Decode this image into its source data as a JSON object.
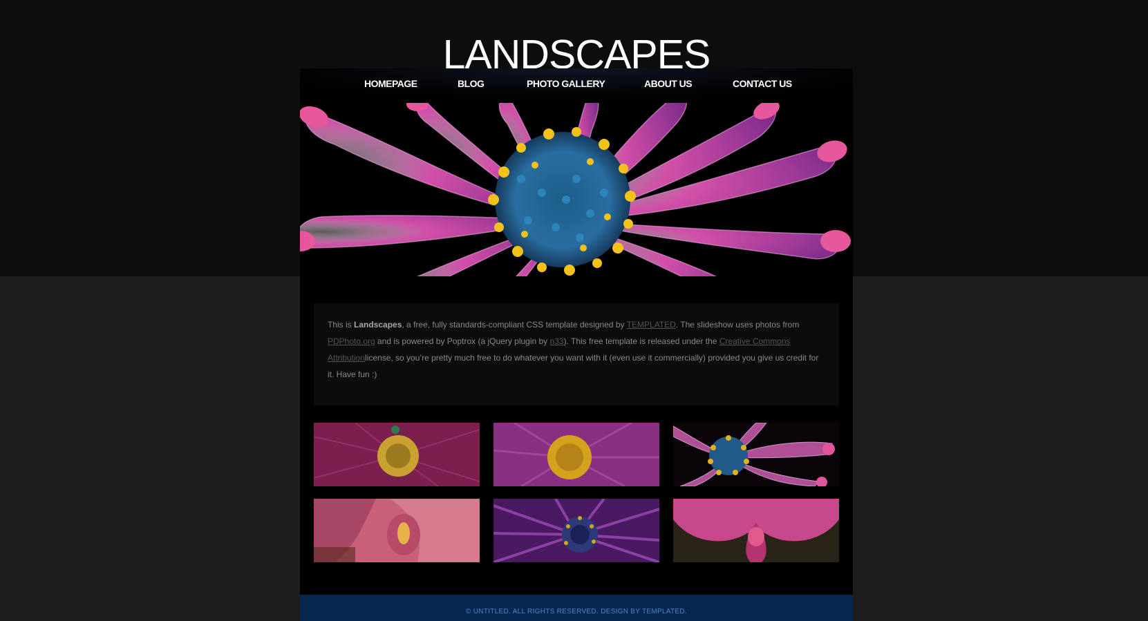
{
  "site": {
    "title": "LANDSCAPES"
  },
  "nav": {
    "items": [
      {
        "label": "HOMEPAGE"
      },
      {
        "label": "BLOG"
      },
      {
        "label": "PHOTO GALLERY"
      },
      {
        "label": "ABOUT US"
      },
      {
        "label": "CONTACT US"
      }
    ]
  },
  "intro": {
    "part1": "This is ",
    "brand": "Landscapes",
    "part2": ", a free, fully standards-compliant CSS template designed by ",
    "link_templated": "TEMPLATED",
    "part3": ". The slideshow uses photos from ",
    "link_pdphoto": "PDPhoto.org",
    "part4": " and is powered by Poptrox (a jQuery plugin by ",
    "link_n33": "n33",
    "part5": "). This free template is released under the ",
    "link_cc": "Creative Commons Attribution",
    "part6": "license, so you’re pretty much free to do whatever you want with it (even use it commercially) provided you give us credit for it. Have fun :)"
  },
  "gallery": {
    "thumbnails": [
      {
        "name": "pink-flower-bee"
      },
      {
        "name": "purple-daisy"
      },
      {
        "name": "pink-osteospermum"
      },
      {
        "name": "pink-orchid-closeup"
      },
      {
        "name": "violet-daisy"
      },
      {
        "name": "pink-orchid"
      }
    ]
  },
  "footer": {
    "text": "© UNTITLED. ALL RIGHTS RESERVED. DESIGN BY TEMPLATED."
  },
  "colors": {
    "page_background": "#1d1d1d",
    "header_background": "#0d0d0d",
    "content_background": "#000000",
    "footer_background": "#062850",
    "footer_text": "#4f83c8",
    "nav_text": "#ffffff"
  }
}
